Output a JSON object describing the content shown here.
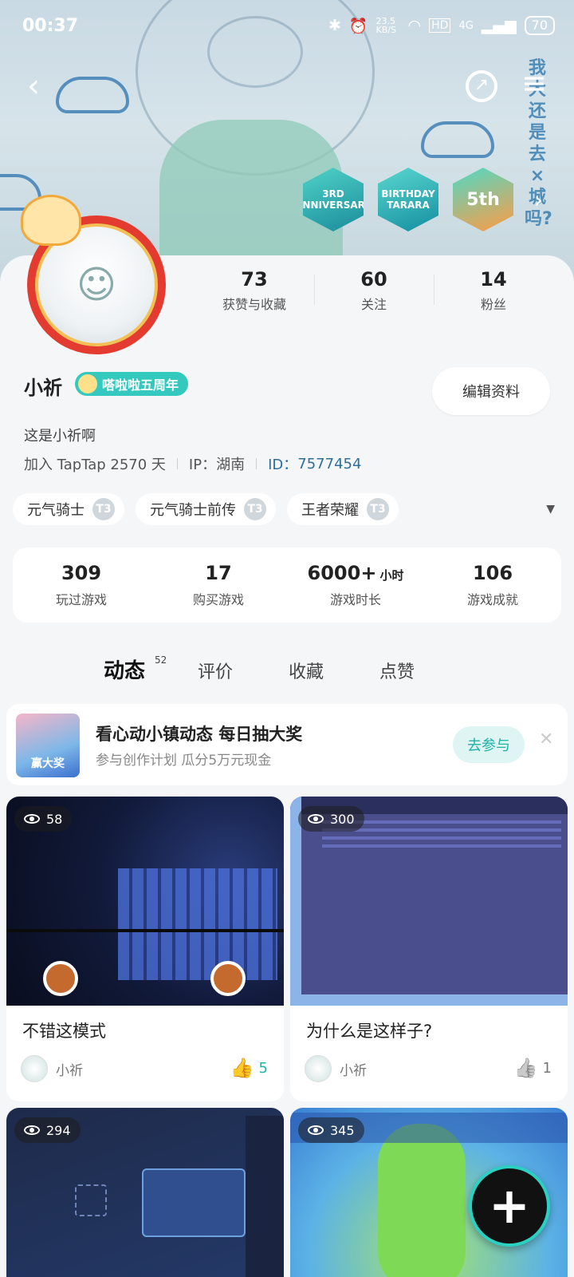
{
  "status_bar": {
    "time": "00:37",
    "network_speed": "23.5 KB/S",
    "hd": "HD",
    "signal": "4G",
    "battery": "70"
  },
  "header": {
    "back_icon": "back-arrow-icon",
    "share_icon": "share-icon",
    "menu_icon": "menu-icon"
  },
  "banner": {
    "vertical_text": "我大还是去×城吗?"
  },
  "badges": [
    {
      "label": "3RD ANNIVERSARY"
    },
    {
      "label": "BIRTHDAY TARARA"
    },
    {
      "label": "5th"
    }
  ],
  "profile": {
    "name": "小祈",
    "anniversary_badge": "嗒啦啦五周年",
    "edit_button": "编辑资料",
    "bio": "这是小祈啊",
    "join_text": "加入 TapTap 2570 天",
    "ip_text": "IP：湖南",
    "id_label": "ID：",
    "id_value": "7577454"
  },
  "social_stats": [
    {
      "value": "73",
      "label": "获赞与收藏"
    },
    {
      "value": "60",
      "label": "关注"
    },
    {
      "value": "14",
      "label": "粉丝"
    }
  ],
  "played_games": [
    {
      "name": "元气骑士",
      "badge": "T3"
    },
    {
      "name": "元气骑士前传",
      "badge": "T3"
    },
    {
      "name": "王者荣耀",
      "badge": "T3"
    }
  ],
  "game_stats": [
    {
      "value": "309",
      "unit": "",
      "label": "玩过游戏"
    },
    {
      "value": "17",
      "unit": "",
      "label": "购买游戏"
    },
    {
      "value": "6000+",
      "unit": "小时",
      "label": "游戏时长"
    },
    {
      "value": "106",
      "unit": "",
      "label": "游戏成就"
    }
  ],
  "tabs": [
    {
      "label": "动态",
      "count": "52",
      "active": true
    },
    {
      "label": "评价"
    },
    {
      "label": "收藏"
    },
    {
      "label": "点赞"
    }
  ],
  "promo": {
    "thumb_text": "赢大奖",
    "title": "看心动小镇动态 每日抽大奖",
    "subtitle": "参与创作计划 瓜分5万元现金",
    "button": "去参与"
  },
  "posts": [
    {
      "views": "58",
      "title": "不错这模式",
      "author": "小祈",
      "likes": "5",
      "liked": true
    },
    {
      "views": "300",
      "title": "为什么是这样子?",
      "author": "小祈",
      "likes": "1",
      "liked": false
    },
    {
      "views": "294"
    },
    {
      "views": "345"
    }
  ],
  "colors": {
    "accent": "#27c7b8",
    "like_active": "#1fb3a5",
    "id_link": "#2e6f99"
  }
}
